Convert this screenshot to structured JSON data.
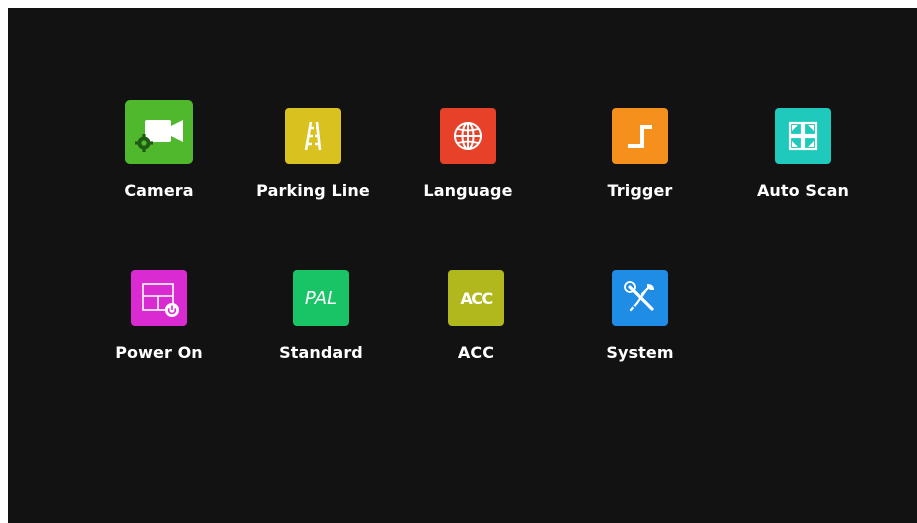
{
  "menu": {
    "items": [
      {
        "id": "camera",
        "label": "Camera",
        "icon": "camera-settings-icon",
        "color": "#4fb82c"
      },
      {
        "id": "parking-line",
        "label": "Parking Line",
        "icon": "parking-line-icon",
        "color": "#d9c21f"
      },
      {
        "id": "language",
        "label": "Language",
        "icon": "globe-icon",
        "color": "#e8412a"
      },
      {
        "id": "trigger",
        "label": "Trigger",
        "icon": "trigger-step-icon",
        "color": "#f5901d"
      },
      {
        "id": "auto-scan",
        "label": "Auto Scan",
        "icon": "quad-scan-icon",
        "color": "#1fc9bb"
      },
      {
        "id": "power-on",
        "label": "Power On",
        "icon": "split-screen-power-icon",
        "color": "#d92bd1"
      },
      {
        "id": "standard",
        "label": "Standard",
        "icon": "pal-icon",
        "icon_text": "PAL",
        "color": "#18c466"
      },
      {
        "id": "acc",
        "label": "ACC",
        "icon": "acc-icon",
        "icon_text": "ACC",
        "color": "#b0b81d"
      },
      {
        "id": "system",
        "label": "System",
        "icon": "tools-icon",
        "color": "#1f8ce5"
      }
    ]
  }
}
